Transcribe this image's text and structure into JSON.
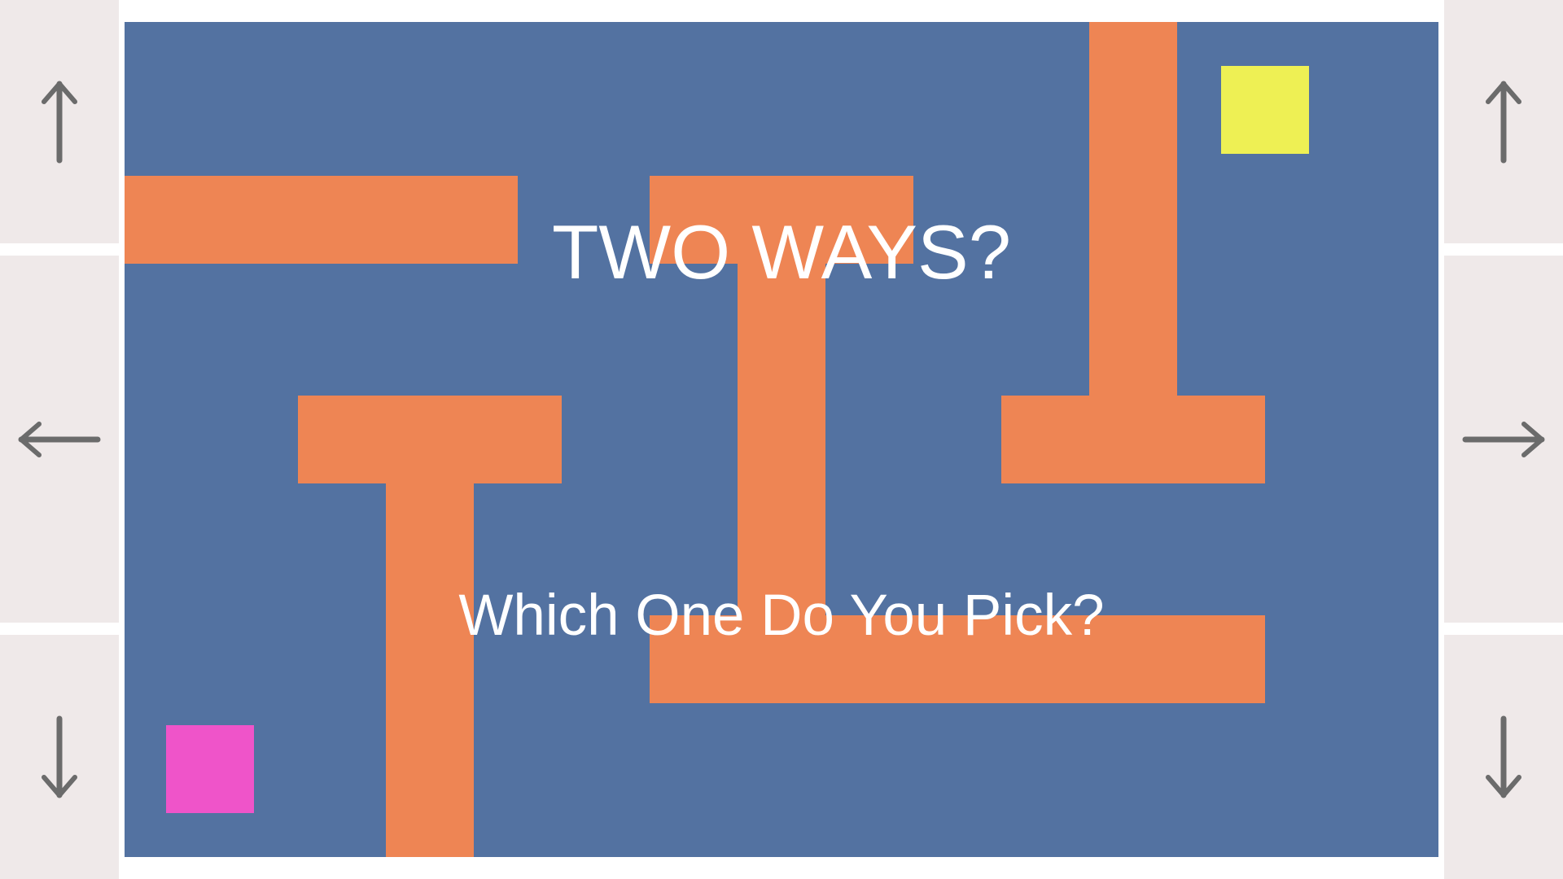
{
  "game": {
    "title": "TWO WAYS?",
    "subtitle": "Which One Do You Pick?"
  },
  "controls": {
    "left": [
      {
        "name": "up-arrow-icon",
        "direction": "up",
        "glyph": "↑"
      },
      {
        "name": "left-arrow-icon",
        "direction": "left",
        "glyph": "←"
      },
      {
        "name": "down-arrow-icon",
        "direction": "down",
        "glyph": "↓"
      }
    ],
    "right": [
      {
        "name": "up-arrow-icon",
        "direction": "up",
        "glyph": "↑"
      },
      {
        "name": "right-arrow-icon",
        "direction": "right",
        "glyph": "→"
      },
      {
        "name": "down-arrow-icon",
        "direction": "down",
        "glyph": "↓"
      }
    ]
  },
  "colors": {
    "board": "#5372a1",
    "wall": "#ee8554",
    "player": "#ef54c9",
    "goal": "#eef054",
    "control_bg": "#efe9e9",
    "arrow": "#6b6b6b",
    "text": "#ffffff"
  }
}
